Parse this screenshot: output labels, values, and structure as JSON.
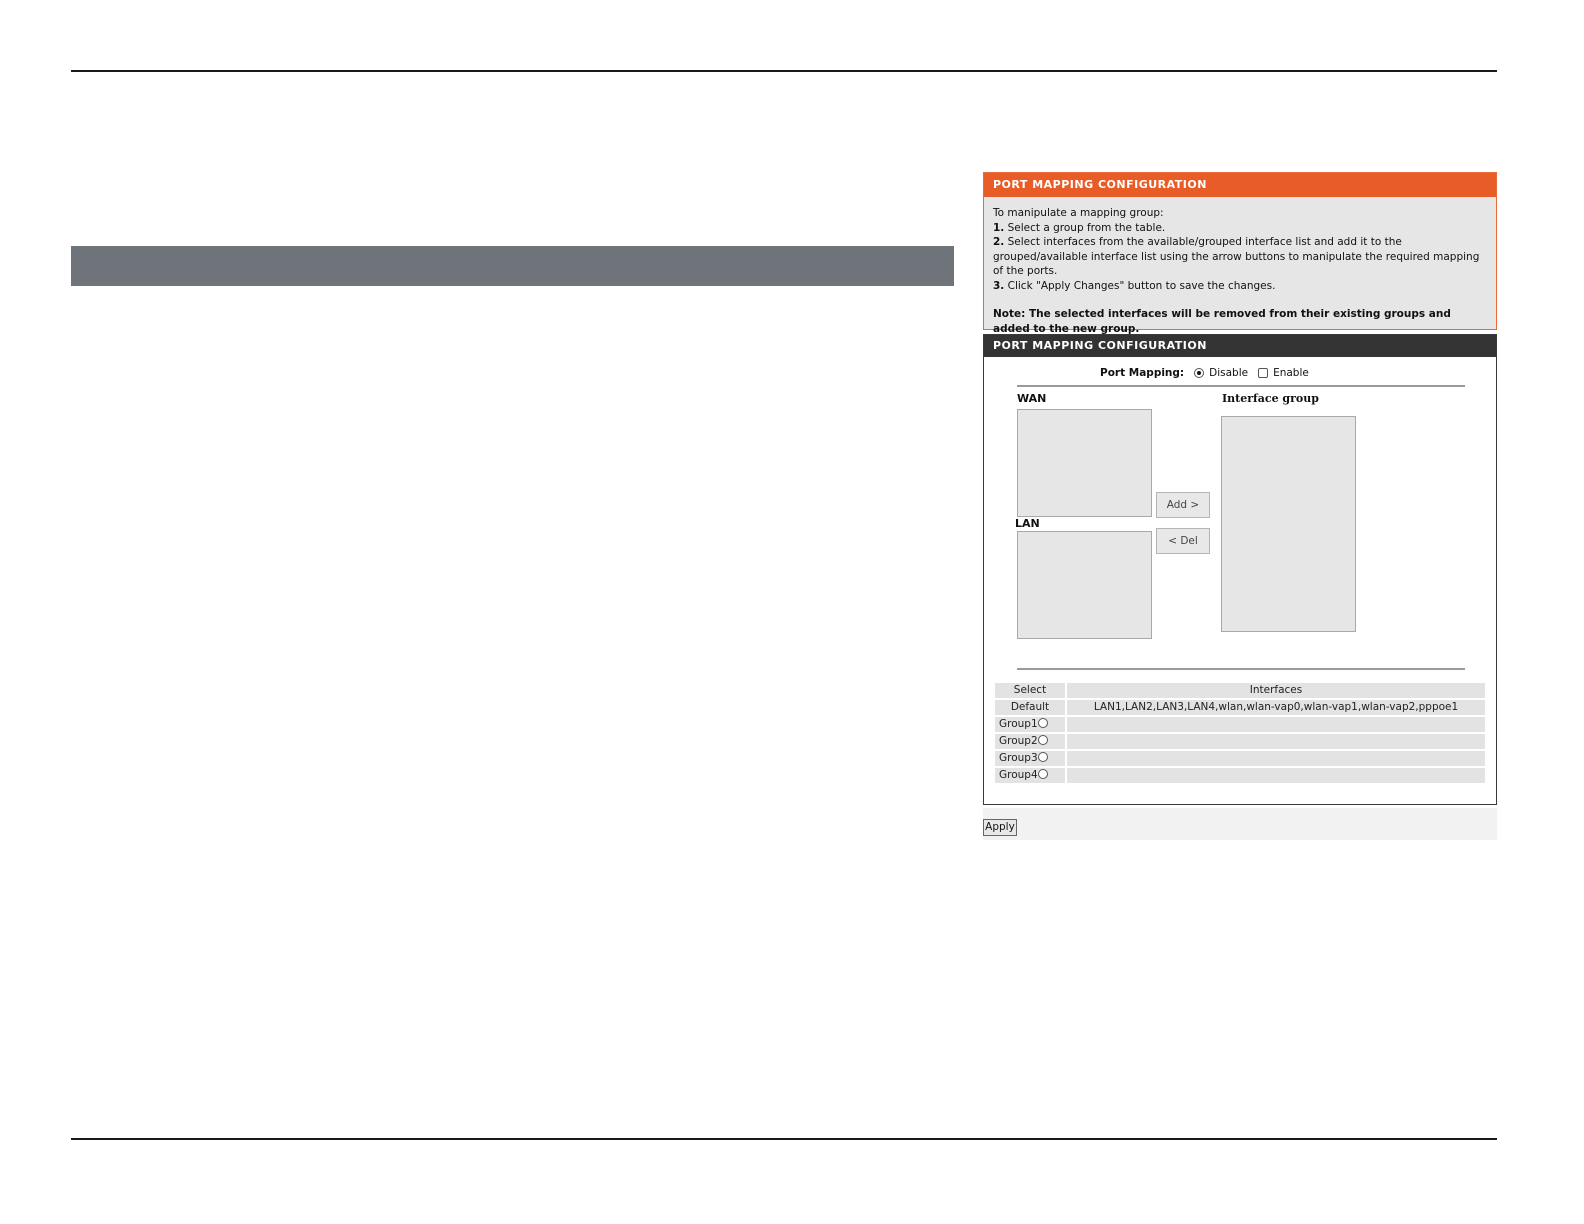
{
  "info_panel": {
    "title": "PORT MAPPING CONFIGURATION",
    "intro": "To manipulate a mapping group:",
    "steps": [
      {
        "num": "1.",
        "text": " Select a group from the table."
      },
      {
        "num": "2.",
        "text": " Select interfaces from the available/grouped interface list and add it to the grouped/available interface list using the arrow buttons to manipulate the required mapping of the ports."
      },
      {
        "num": "3.",
        "text": " Click \"Apply Changes\" button to save the changes."
      }
    ],
    "note": "Note: The selected interfaces will be removed from their existing groups and added to the new group."
  },
  "config_panel": {
    "title": "PORT MAPPING CONFIGURATION",
    "port_mapping_label": "Port Mapping:",
    "disable_label": "Disable",
    "enable_label": "Enable",
    "selected_option": "Disable",
    "wan_label": "WAN",
    "lan_label": "LAN",
    "interface_group_label": "Interface group",
    "add_label": "Add >",
    "del_label": "< Del"
  },
  "group_table": {
    "headers": [
      "Select",
      "Interfaces"
    ],
    "rows": [
      {
        "select": "Default",
        "interfaces": "LAN1,LAN2,LAN3,LAN4,wlan,wlan-vap0,wlan-vap1,wlan-vap2,pppoe1"
      },
      {
        "select": "Group1",
        "interfaces": ""
      },
      {
        "select": "Group2",
        "interfaces": ""
      },
      {
        "select": "Group3",
        "interfaces": ""
      },
      {
        "select": "Group4",
        "interfaces": ""
      }
    ]
  },
  "apply_label": "Apply"
}
